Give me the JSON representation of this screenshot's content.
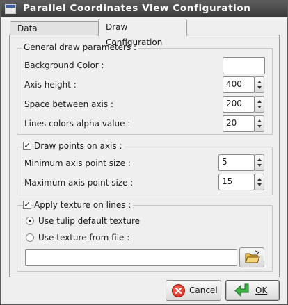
{
  "window": {
    "title": "Parallel Coordinates View Configuration"
  },
  "tabs": [
    {
      "label": "Data Configuration",
      "active": false
    },
    {
      "label": "Draw Configuration",
      "active": true
    }
  ],
  "general": {
    "title": "General draw parameters :",
    "background_label": "Background Color :",
    "background_color": "#ffffff",
    "axis_height_label": "Axis height :",
    "axis_height": "400",
    "space_label": "Space between axis :",
    "space": "200",
    "alpha_label": "Lines colors alpha value :",
    "alpha": "20"
  },
  "points": {
    "checkbox_label": "Draw points on axis :",
    "checked": true,
    "min_label": "Minimum axis point size :",
    "min_value": "5",
    "max_label": "Maximum axis point size :",
    "max_value": "15"
  },
  "texture": {
    "checkbox_label": "Apply texture on lines :",
    "checked": true,
    "radio_default_label": "Use tulip default texture",
    "radio_file_label": "Use texture from file :",
    "selected": "default",
    "file_path": ""
  },
  "buttons": {
    "cancel_label": "Cancel",
    "ok_label": "OK"
  },
  "icons": {
    "window": "window-icon",
    "browse": "folder-open-icon",
    "cancel": "cancel-icon",
    "ok": "ok-arrow-icon"
  },
  "colors": {
    "titlebar": "#4a4a4a",
    "cancel_icon": "#d11c10",
    "ok_icon": "#3cb043"
  }
}
